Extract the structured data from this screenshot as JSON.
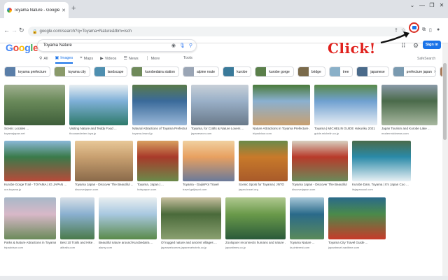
{
  "browser": {
    "tab_title": "Toyama Nature - Google Sea...",
    "url": "google.com/search?q=Toyama+Nature&tbm=isch"
  },
  "search": {
    "query": "Toyama Nature",
    "logo_text": "Google",
    "signin_label": "Sign in",
    "safesearch_label": "SafeSearch"
  },
  "annotation": {
    "click_text": "Click!"
  },
  "filters": [
    {
      "label": "All",
      "icon": "search-icon"
    },
    {
      "label": "Images",
      "icon": "image-icon",
      "active": true
    },
    {
      "label": "Maps",
      "icon": "map-pin-icon"
    },
    {
      "label": "Videos",
      "icon": "video-icon"
    },
    {
      "label": "News",
      "icon": "news-icon"
    },
    {
      "label": "More",
      "icon": "more-icon"
    }
  ],
  "tools_label": "Tools",
  "chips": [
    {
      "label": "toyama prefecture",
      "color": "#5a7ea8"
    },
    {
      "label": "toyama city",
      "color": "#8a9a6a"
    },
    {
      "label": "landscape",
      "color": "#4e8fb0"
    },
    {
      "label": "kurobedaira station",
      "color": "#6f8a5a"
    },
    {
      "label": "alpine route",
      "color": "#9aa5b5"
    },
    {
      "label": "kurobe",
      "color": "#3a7a9a"
    },
    {
      "label": "kurobe gorge",
      "color": "#5a7f4a"
    },
    {
      "label": "bridge",
      "color": "#7a6a4a"
    },
    {
      "label": "tree",
      "color": "#8ab0c8"
    },
    {
      "label": "japanese",
      "color": "#4a6a8a"
    },
    {
      "label": "prefecture japan",
      "color": "#7a9ab0"
    },
    {
      "label": "japan",
      "color": "#a87a5a"
    }
  ],
  "results": [
    {
      "caption": "Scenic Locales ...",
      "source": "toyamajapan.net",
      "colors": [
        "#6a8a5a",
        "#3e5e3a",
        "#a0b090"
      ]
    },
    {
      "caption": "Visiting Nature and Teddy Food ...",
      "source": "thousanderien.toya.jp",
      "colors": [
        "#7fb0d8",
        "#2e7a6a",
        "#e8eef2"
      ]
    },
    {
      "caption": "Natural Attractions of Toyama Prefecture ...",
      "source": "toyama-brand.jp",
      "colors": [
        "#3a6a9a",
        "#9ab8d8",
        "#5a7a4a"
      ]
    },
    {
      "caption": "Toyama, for Crafts & Nature Lovers ...",
      "source": "japaneseon.com",
      "colors": [
        "#9ab0c8",
        "#6a7a8a",
        "#c8d0d8"
      ]
    },
    {
      "caption": "Nature Attractions in Toyama Prefecture ...",
      "source": "tripadvisor.com",
      "colors": [
        "#8ab0d0",
        "#c8a070",
        "#4a7a3a"
      ]
    },
    {
      "caption": "Toyama | MICHELIN GUIDE Hokuriku 2021",
      "source": "guide.michelin.co.jp",
      "colors": [
        "#6fa0d0",
        "#e8eef4",
        "#5a8a4a"
      ]
    },
    {
      "caption": "Japan Tourism and Kurobe Lake ...",
      "source": "modernnicknews.com",
      "colors": [
        "#4a6a4a",
        "#a8b8a0",
        "#8a9aa8"
      ]
    },
    {
      "caption": "Kurobe Gorge Trail - TOYAMA | IG JAPAN ...",
      "source": "ura.toyama.jp",
      "colors": [
        "#3a7a4a",
        "#b84a3a",
        "#8ab8d8"
      ]
    },
    {
      "caption": "Toyama Japan - Discover The Beautiful ...",
      "source": "discoverjapan.com",
      "colors": [
        "#c8a070",
        "#8a6a4a",
        "#e8c898"
      ]
    },
    {
      "caption": "Toyama, Japan | ...",
      "source": "hotspapan.com",
      "colors": [
        "#a83a2a",
        "#6a8a4a",
        "#d8a060"
      ]
    },
    {
      "caption": "Toyama - GaijinPot Travel",
      "source": "travel.gaijinpot.com",
      "colors": [
        "#e8a060",
        "#6a7a9a",
        "#f0d0a0"
      ]
    },
    {
      "caption": "Scenic Spots for Toyama | JNTO",
      "source": "japan-travel.org",
      "colors": [
        "#c87a2a",
        "#a85a2a",
        "#6a8a4a"
      ]
    },
    {
      "caption": "Toyama Japan - Discover The Beautiful ...",
      "source": "discoverjapan.com",
      "colors": [
        "#b83a2a",
        "#6a8a5a",
        "#d8d0c0"
      ]
    },
    {
      "caption": "Kurobe Dam, Toyama | It's Japan Coo ...",
      "source": "itsjapancool.com",
      "colors": [
        "#2a8aa8",
        "#e8f0f4",
        "#4a6a4a"
      ]
    },
    {
      "caption": "Parks & Nature Attractions in Toyama ...",
      "source": "tripadvisor.com",
      "colors": [
        "#d8b8c8",
        "#6a8a5a",
        "#a8b8c8"
      ]
    },
    {
      "caption": "Best 10 Trails and Hike ...",
      "source": "alltrails.com",
      "colors": [
        "#8ab0d0",
        "#4a7a4a",
        "#d8e0e8"
      ]
    },
    {
      "caption": "Beautiful nature around Kurobedaira ...",
      "source": "alamy.com",
      "colors": [
        "#a8c8e0",
        "#5a8a4a",
        "#e8eef0"
      ]
    },
    {
      "caption": "Of rugged nature and ancient villages ...",
      "source": "japanwelcomes.japanesehotels.co.jp",
      "colors": [
        "#4a6a3a",
        "#8aa070",
        "#c8c0a0"
      ]
    },
    {
      "caption": "Zoolopoer reconnects humans and nature ...",
      "source": "japantimes.co.jp",
      "colors": [
        "#6a9a4a",
        "#2a5a3a",
        "#b0c890"
      ]
    },
    {
      "caption": "Toyama Nature ...",
      "source": "kr.pinterest.com",
      "colors": [
        "#2a6a8a",
        "#5a8a5a",
        "#a8c8d8"
      ]
    },
    {
      "caption": "Toyama City Travel Guide ...",
      "source": "japantravel.navitime.com",
      "colors": [
        "#4a8a4a",
        "#c83a2a",
        "#2a6a8a"
      ]
    },
    {
      "caption": "Best 10 Walking Trails in Toyama ...",
      "source": "alltrails.com",
      "colors": [
        "#3a6a3a",
        "#7aa060",
        "#c8d8c0"
      ]
    }
  ],
  "colors": {
    "accent": "#1a73e8",
    "annotation_red": "#e0201c"
  }
}
